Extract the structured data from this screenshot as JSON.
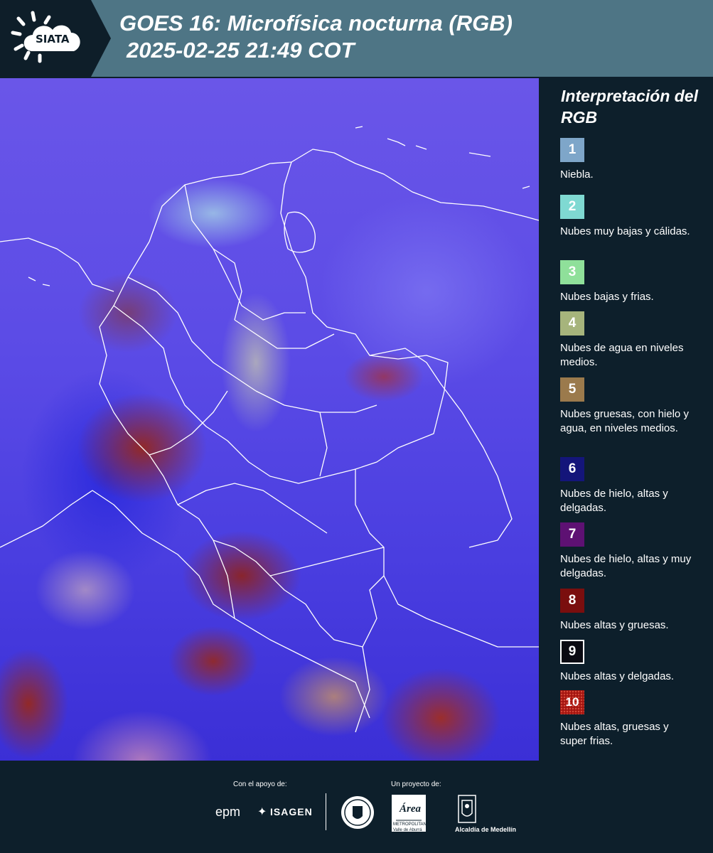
{
  "header": {
    "logo_text": "SIATA",
    "title": "GOES 16: Microfísica nocturna (RGB)",
    "subtitle": "2025-02-25 21:49 COT"
  },
  "legend": {
    "title": "Interpretación del RGB",
    "items": [
      {
        "number": "1",
        "label": "Niebla.",
        "color": "#7ea6c9"
      },
      {
        "number": "2",
        "label": "Nubes muy bajas y cálidas.",
        "color": "#7fd9d2"
      },
      {
        "number": "3",
        "label": "Nubes bajas y frias.",
        "color": "#8fe09a"
      },
      {
        "number": "4",
        "label": "Nubes de agua en niveles medios.",
        "color": "#a6b47c"
      },
      {
        "number": "5",
        "label": "Nubes gruesas, con hielo y agua, en niveles medios.",
        "color": "#9b7a4c"
      },
      {
        "number": "6",
        "label": "Nubes de hielo, altas y delgadas.",
        "color": "#14157a"
      },
      {
        "number": "7",
        "label": "Nubes de hielo, altas y muy delgadas.",
        "color": "#5e1173"
      },
      {
        "number": "8",
        "label": "Nubes altas y gruesas.",
        "color": "#7a0e0e"
      },
      {
        "number": "9",
        "label": "Nubes altas y delgadas.",
        "color": "#0a0a12"
      },
      {
        "number": "10",
        "label": "Nubes altas, gruesas y super frias.",
        "color": "#a3140f"
      }
    ]
  },
  "footer": {
    "support_label": "Con el apoyo de:",
    "project_label": "Un proyecto de:",
    "sponsor1": "epm",
    "sponsor2": "ISAGEN",
    "partner_area": "METROPOLITANA Valle de Aburrá",
    "partner_area_word": "Área",
    "partner_alcaldia": "Alcaldía de Medellín"
  }
}
